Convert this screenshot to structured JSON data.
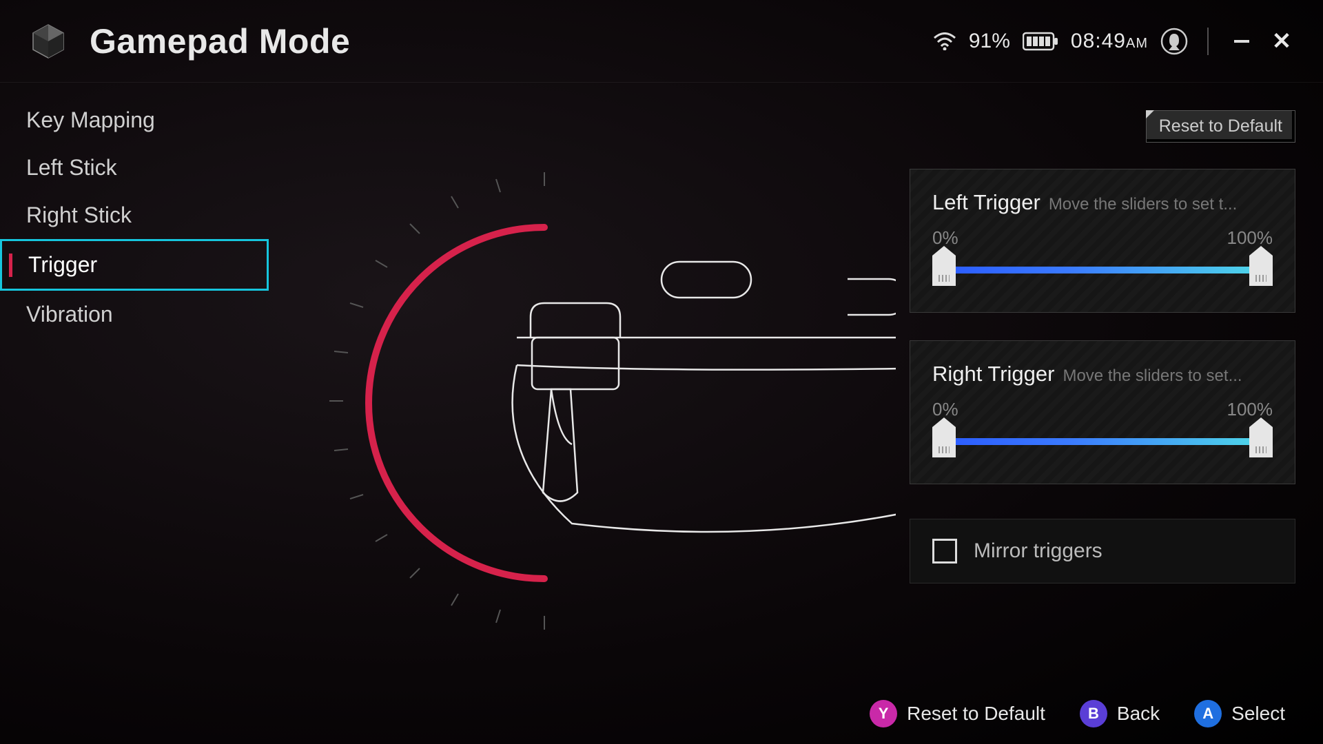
{
  "header": {
    "title": "Gamepad Mode",
    "wifi_percent": "91%",
    "time": "08:49",
    "ampm": "AM"
  },
  "sidebar": {
    "items": [
      {
        "label": "Key Mapping"
      },
      {
        "label": "Left Stick"
      },
      {
        "label": "Right Stick"
      },
      {
        "label": "Trigger"
      },
      {
        "label": "Vibration"
      }
    ],
    "selected_index": 3
  },
  "actions": {
    "reset_default": "Reset to Default"
  },
  "triggers": {
    "left": {
      "title": "Left Trigger",
      "hint": "Move the sliders to set t...",
      "min_label": "0%",
      "max_label": "100%",
      "low": 0,
      "high": 100
    },
    "right": {
      "title": "Right Trigger",
      "hint": "Move the sliders to set...",
      "min_label": "0%",
      "max_label": "100%",
      "low": 0,
      "high": 100
    },
    "mirror": {
      "label": "Mirror triggers",
      "checked": false
    }
  },
  "footer": {
    "y": "Reset to Default",
    "b": "Back",
    "a": "Select"
  },
  "colors": {
    "accent_cyan": "#16c5dd",
    "accent_red": "#d6224b"
  }
}
